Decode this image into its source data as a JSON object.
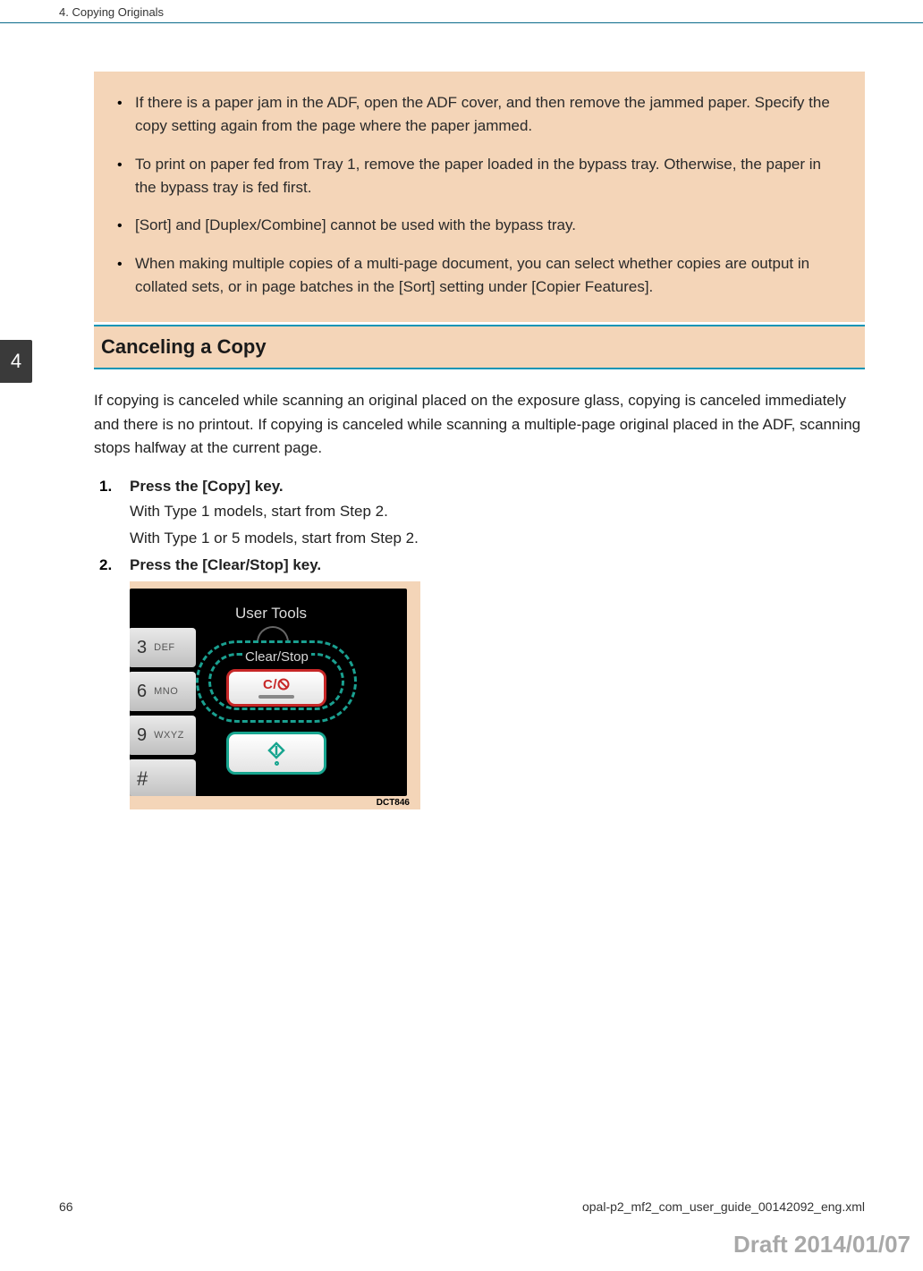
{
  "header": {
    "chapter_title": "4. Copying Originals"
  },
  "side_tab": {
    "chapter_number": "4"
  },
  "notes": {
    "items": [
      "If there is a paper jam in the ADF, open the ADF cover, and then remove the jammed paper. Specify the copy setting again from the page where the paper jammed.",
      "To print on paper fed from Tray 1, remove the paper loaded in the bypass tray. Otherwise, the paper in the bypass tray is fed first.",
      "[Sort] and [Duplex/Combine] cannot be used with the bypass tray.",
      "When making multiple copies of a multi-page document, you can select whether copies are output in collated sets, or in page batches in the [Sort] setting under [Copier Features]."
    ]
  },
  "section": {
    "heading": "Canceling a Copy",
    "intro": "If copying is canceled while scanning an original placed on the exposure glass, copying is canceled immediately and there is no printout. If copying is canceled while scanning a multiple-page original placed in the ADF, scanning stops halfway at the current page."
  },
  "steps": [
    {
      "title": "Press the [Copy] key.",
      "sub": [
        "With Type 1 models, start from Step 2.",
        "With Type 1 or 5 models, start from Step 2."
      ]
    },
    {
      "title": "Press the [Clear/Stop] key.",
      "sub": []
    }
  ],
  "panel": {
    "user_tools_label": "User Tools",
    "clear_stop_label": "Clear/Stop",
    "cs_button_text": "C/",
    "keys": [
      {
        "num": "3",
        "ltr": "DEF"
      },
      {
        "num": "6",
        "ltr": "MNO"
      },
      {
        "num": "9",
        "ltr": "WXYZ"
      },
      {
        "num": "#",
        "ltr": ""
      }
    ],
    "code": "DCT846"
  },
  "footer": {
    "page_number": "66",
    "filename": "opal-p2_mf2_com_user_guide_00142092_eng.xml"
  },
  "draft_stamp": "Draft 2014/01/07"
}
